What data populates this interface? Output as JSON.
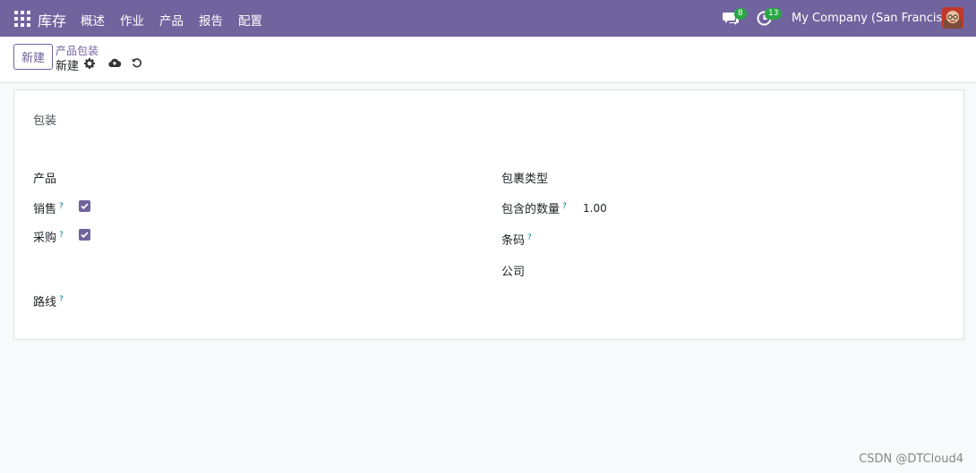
{
  "navbar": {
    "app_name": "库存",
    "menu": [
      "概述",
      "作业",
      "产品",
      "报告",
      "配置"
    ],
    "chat_count": "8",
    "activity_count": "13",
    "company": "My Company (San Francisco)"
  },
  "control": {
    "new_label": "新建",
    "breadcrumb_parent": "产品包装",
    "breadcrumb_current": "新建"
  },
  "form": {
    "packaging_placeholder": "包装",
    "product_label": "产品",
    "sales_label": "销售",
    "sales_checked": true,
    "purchase_label": "采购",
    "purchase_checked": true,
    "routes_label": "路线",
    "package_type_label": "包裹类型",
    "qty_label": "包含的数量",
    "qty_value": "1.00",
    "barcode_label": "条码",
    "company_label": "公司",
    "help_mark": "?"
  },
  "watermark": "CSDN @DTCloud4",
  "colors": {
    "brand": "#71639e",
    "badge": "#28a745",
    "help": "#017e84"
  }
}
